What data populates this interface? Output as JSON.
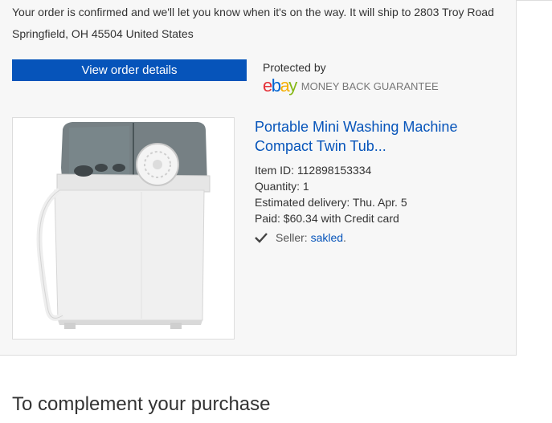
{
  "order": {
    "confirmation_text": "Your order is confirmed and we'll let you know when it's on the way. It will ship to 2803 Troy Road Springfield, OH 45504 United States",
    "view_details_label": "View order details"
  },
  "guarantee": {
    "protected_by": "Protected by",
    "logo_e": "e",
    "logo_b": "b",
    "logo_a": "a",
    "logo_y": "y",
    "label": "MONEY BACK GUARANTEE"
  },
  "item": {
    "title": "Portable Mini Washing Machine Compact Twin Tub...",
    "item_id": "Item ID: 112898153334",
    "quantity": "Quantity: 1",
    "delivery": "Estimated delivery: Thu. Apr. 5",
    "paid": "Paid: $60.34 with Credit card",
    "seller_prefix": "Seller: ",
    "seller_name": "sakled",
    "seller_suffix": "."
  },
  "section": {
    "complement_heading": "To complement your purchase"
  },
  "colors": {
    "primary_button": "#0654ba",
    "link": "#0654ba",
    "card_background": "#f7f7f7"
  }
}
